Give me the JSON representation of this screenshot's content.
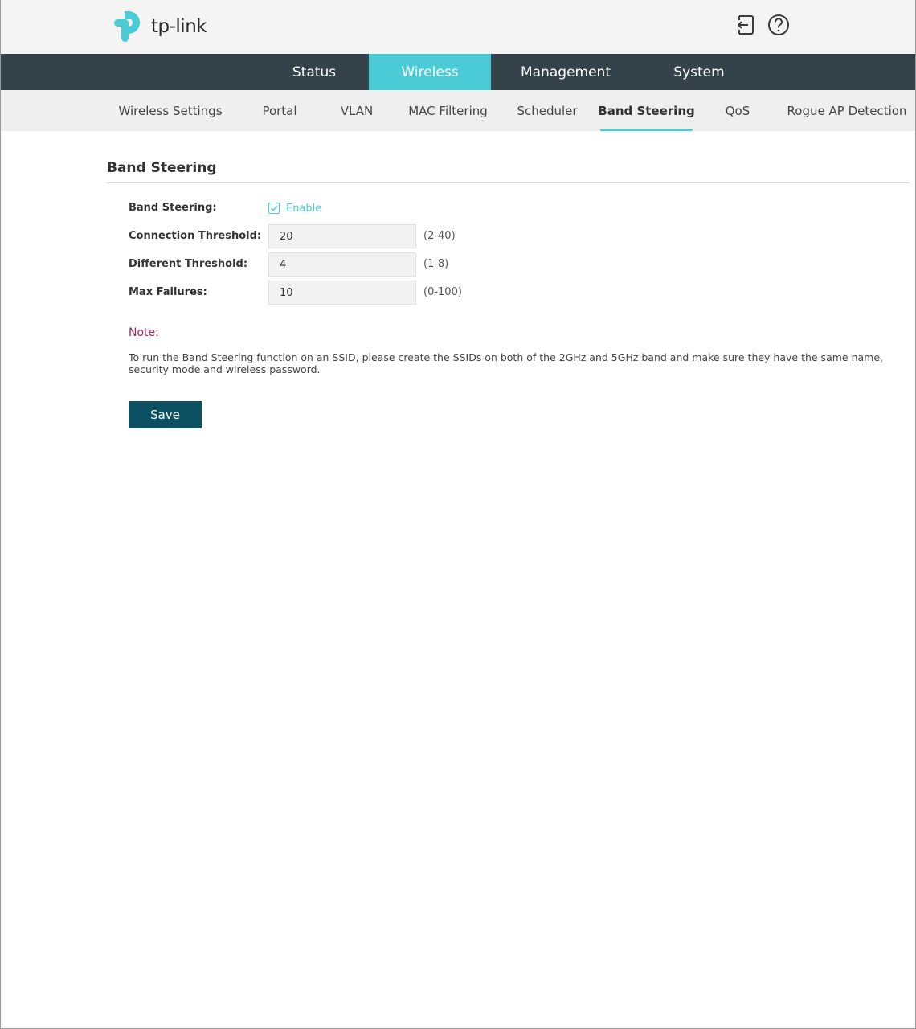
{
  "brand": {
    "name": "tp-link",
    "color": "#4acbd6"
  },
  "header": {
    "icons": [
      "logout-icon",
      "help-icon"
    ]
  },
  "main_nav": {
    "tabs": [
      {
        "label": "Status",
        "active": false
      },
      {
        "label": "Wireless",
        "active": true
      },
      {
        "label": "Management",
        "active": false
      },
      {
        "label": "System",
        "active": false
      }
    ],
    "bg_color": "#34424a",
    "active_color": "#4acbd6"
  },
  "sub_nav": {
    "tabs": [
      {
        "label": "Wireless Settings",
        "active": false
      },
      {
        "label": "Portal",
        "active": false
      },
      {
        "label": "VLAN",
        "active": false
      },
      {
        "label": "MAC Filtering",
        "active": false
      },
      {
        "label": "Scheduler",
        "active": false
      },
      {
        "label": "Band Steering",
        "active": true
      },
      {
        "label": "QoS",
        "active": false
      },
      {
        "label": "Rogue AP Detection",
        "active": false
      }
    ]
  },
  "section": {
    "title": "Band Steering",
    "band_steering": {
      "label": "Band Steering:",
      "checkbox_label": "Enable",
      "checked": true
    },
    "fields": [
      {
        "label": "Connection Threshold:",
        "value": "20",
        "range": "(2-40)"
      },
      {
        "label": "Different Threshold:",
        "value": "4",
        "range": "(1-8)"
      },
      {
        "label": "Max Failures:",
        "value": "10",
        "range": "(0-100)"
      }
    ]
  },
  "note": {
    "title": "Note:",
    "text": "To run the Band Steering function on an SSID, please create the SSIDs on both of the 2GHz and 5GHz band and make sure they have the same name, security mode and wireless password.",
    "title_color": "#a0255a"
  },
  "actions": {
    "save_label": "Save",
    "save_color": "#0c5161"
  }
}
